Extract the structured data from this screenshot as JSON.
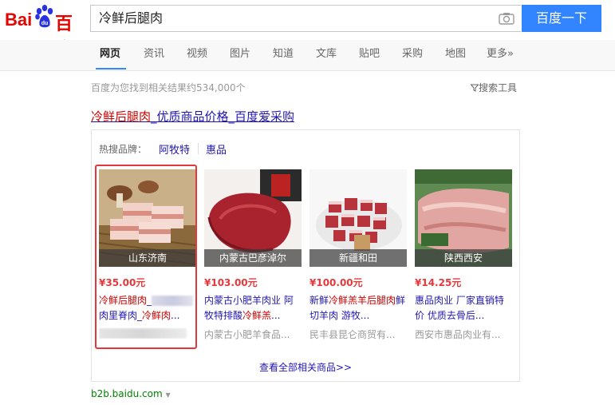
{
  "header": {
    "logo_left": "Bai",
    "logo_right": "百度",
    "query": "冷鲜后腿肉",
    "search_button": "百度一下"
  },
  "nav": {
    "tabs": [
      "网页",
      "资讯",
      "视频",
      "图片",
      "知道",
      "文库",
      "贴吧",
      "采购",
      "地图",
      "更多»"
    ],
    "active": "网页"
  },
  "results": {
    "count_text": "百度为您找到相关结果约534,000个",
    "tools_label": "搜索工具",
    "title_highlight": "冷鲜后腿肉",
    "title_rest": "_优质商品价格_百度爱采购",
    "hot_brands_label": "热搜品牌：",
    "brands": [
      "阿牧特",
      "惠品"
    ],
    "products": [
      {
        "location": "山东济南",
        "price": "¥35.00元",
        "desc_hl": "冷鲜后腿肉",
        "desc_rest": "_",
        "desc_line2_a": "肉里脊肉_",
        "desc_line2_hl": "冷鲜肉",
        "desc_line2_b": "...",
        "seller": ""
      },
      {
        "location": "内蒙古巴彦淖尔",
        "price": "¥103.00元",
        "desc_a": "内蒙古小肥羊肉业 阿牧特排酸",
        "desc_hl": "冷鲜羔",
        "desc_b": "...",
        "seller": "内蒙古小肥羊食品..."
      },
      {
        "location": "新疆和田",
        "price": "¥100.00元",
        "desc_a": "新鲜",
        "desc_hl": "冷鲜羔羊后腿肉",
        "desc_b": "鲜切羊肉 游牧...",
        "seller": "民丰县昆仑商贸有..."
      },
      {
        "location": "陕西西安",
        "price": "¥14.25元",
        "desc_a": "惠品肉业 厂家直销特价 优质去骨后...",
        "seller": "西安市惠品肉业有..."
      }
    ],
    "view_all": "查看全部相关商品>>",
    "source": "b2b.baidu.com"
  },
  "colors": {
    "accent": "#3385ff",
    "link": "#2116b3",
    "highlight": "#c00000",
    "price": "#e4393c"
  }
}
